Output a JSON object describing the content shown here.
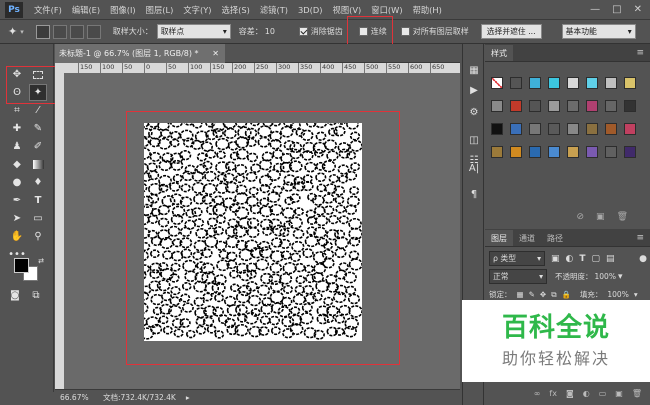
{
  "app": {
    "logo": "Ps"
  },
  "menu": [
    "文件(F)",
    "编辑(E)",
    "图像(I)",
    "图层(L)",
    "文字(Y)",
    "选择(S)",
    "滤镜(T)",
    "3D(D)",
    "视图(V)",
    "窗口(W)",
    "帮助(H)"
  ],
  "window_controls": [
    "—",
    "□",
    "✕"
  ],
  "options": {
    "sample_size_label": "取样大小：",
    "sample_size_value": "取样点",
    "tolerance_label": "容差：",
    "tolerance_value": "10",
    "antialias_label": "消除锯齿",
    "contiguous_label": "连续",
    "all_layers_label": "对所有图层取样",
    "select_refine_label": "选择并遮住 ...",
    "workspace_value": "基本功能"
  },
  "document": {
    "tab_title": "未标题-1 @ 66.7% (图层 1, RGB/8) *",
    "zoom": "66.67%",
    "doc_info": "文档:732.4K/732.4K",
    "ruler_ticks": [
      "150",
      "100",
      "50",
      "0",
      "50",
      "100",
      "150",
      "200",
      "250",
      "300",
      "350",
      "400",
      "450",
      "500",
      "550",
      "600",
      "650"
    ]
  },
  "panels": {
    "styles_tab": "样式",
    "layers_tabs": [
      "图层",
      "通道",
      "路径"
    ],
    "kind_label": "ρ 类型",
    "blend_mode": "正常",
    "opacity_label": "不透明度：",
    "opacity_value": "100%",
    "lock_label": "锁定：",
    "fill_label": "填充：",
    "fill_value": "100%"
  },
  "watermark": {
    "title": "百科全说",
    "subtitle": "助你轻松解决"
  },
  "colors": {
    "accent_red": "#e0333a",
    "watermark_green": "#2fb84a"
  }
}
